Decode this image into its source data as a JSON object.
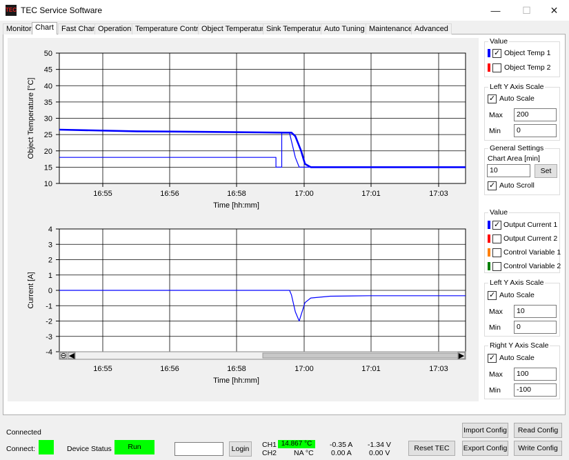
{
  "window": {
    "title": "TEC Service Software",
    "app_icon_text": "TEC",
    "minimize": "—",
    "maximize": "☐",
    "close": "✕"
  },
  "tabs": [
    "Monitor",
    "Chart",
    "Fast Chart",
    "Operation",
    "Temperature Control",
    "Object Temperature",
    "Sink Temperature",
    "Auto Tuning",
    "Maintenance",
    "Advanced"
  ],
  "active_tab": "Chart",
  "temp_panel": {
    "value_title": "Value",
    "items": [
      {
        "label": "Object Temp 1",
        "checked": true,
        "color": "#0000ff"
      },
      {
        "label": "Object Temp 2",
        "checked": false,
        "color": "#ff0000"
      }
    ],
    "left_y_title": "Left Y Axis Scale",
    "auto_scale_label": "Auto Scale",
    "max_label": "Max",
    "max_value": "200",
    "min_label": "Min",
    "min_value": "0",
    "general_title": "General Settings",
    "chart_area_label": "Chart Area [min]",
    "chart_area_value": "10",
    "set_label": "Set",
    "auto_scroll_label": "Auto Scroll"
  },
  "current_panel": {
    "value_title": "Value",
    "items": [
      {
        "label": "Output Current 1",
        "checked": true,
        "color": "#0000ff"
      },
      {
        "label": "Output Current 2",
        "checked": false,
        "color": "#ff0000"
      },
      {
        "label": "Control Variable 1",
        "checked": false,
        "color": "#ff8000"
      },
      {
        "label": "Control Variable 2",
        "checked": false,
        "color": "#008000"
      }
    ],
    "left_y_title": "Left Y Axis Scale",
    "auto_scale_label": "Auto Scale",
    "max_label": "Max",
    "max_value": "10",
    "min_label": "Min",
    "min_value": "0",
    "right_y_title": "Right Y Axis Scale",
    "right_auto_scale_label": "Auto Scale",
    "right_max_label": "Max",
    "right_max_value": "100",
    "right_min_label": "Min",
    "right_min_value": "-100"
  },
  "status": {
    "connected_text": "Connected",
    "connect_label": "Connect:",
    "device_status_label": "Device Status",
    "run_label": "Run",
    "login_input": "",
    "login_label": "Login",
    "ch1_label": "CH1",
    "ch1_temp": "14.867 °C",
    "ch1_current": "-0.35 A",
    "ch1_voltage": "-1.34 V",
    "ch2_label": "CH2",
    "ch2_temp": "NA °C",
    "ch2_current": "0.00 A",
    "ch2_voltage": "0.00 V",
    "reset_tec": "Reset TEC",
    "import_config": "Import Config",
    "read_config": "Read Config",
    "export_config": "Export Config",
    "write_config": "Write Config",
    "status_green": "#00ff00"
  },
  "chart_data": [
    {
      "type": "line",
      "xlabel": "Time [hh:mm]",
      "ylabel": "Object Temperature [°C]",
      "ylim": [
        10,
        50
      ],
      "yticks": [
        "50",
        "45",
        "40",
        "35",
        "30",
        "25",
        "20",
        "15",
        "10"
      ],
      "xticks": [
        "16:55",
        "16:56",
        "16:58",
        "17:00",
        "17:01",
        "17:03"
      ],
      "grid": true,
      "series": [
        {
          "name": "Object Temp 1",
          "color": "#0000ff",
          "style": "thick",
          "x": [
            0,
            2,
            4,
            5.8,
            6.0,
            6.1,
            6.25,
            6.35,
            6.5,
            7.0,
            8.0,
            9.0,
            10.5
          ],
          "y": [
            26.5,
            26.0,
            25.8,
            25.6,
            25.6,
            24.5,
            20,
            16,
            15,
            15,
            15,
            15,
            15
          ]
        },
        {
          "name": "",
          "color": "#0000ff",
          "style": "thin",
          "x": [
            0,
            5.6,
            5.6,
            5.75,
            5.75,
            5.95,
            6.1,
            6.2,
            10.5
          ],
          "y": [
            18,
            18,
            15,
            15,
            25.5,
            25.5,
            18,
            15,
            15
          ]
        }
      ]
    },
    {
      "type": "line",
      "xlabel": "Time [hh:mm]",
      "ylabel": "Current [A]",
      "ylim": [
        -4,
        4
      ],
      "yticks": [
        "4",
        "3",
        "2",
        "1",
        "0",
        "-1",
        "-2",
        "-3",
        "-4"
      ],
      "xticks": [
        "16:55",
        "16:56",
        "16:58",
        "17:00",
        "17:01",
        "17:03"
      ],
      "grid": true,
      "series": [
        {
          "name": "Output Current 1",
          "color": "#0000ff",
          "x": [
            0,
            5.95,
            6.0,
            6.1,
            6.2,
            6.25,
            6.35,
            6.5,
            7.0,
            8.0,
            10.5
          ],
          "y": [
            0,
            0,
            -0.3,
            -1.4,
            -2.0,
            -1.6,
            -0.8,
            -0.5,
            -0.38,
            -0.35,
            -0.35
          ]
        }
      ]
    }
  ]
}
